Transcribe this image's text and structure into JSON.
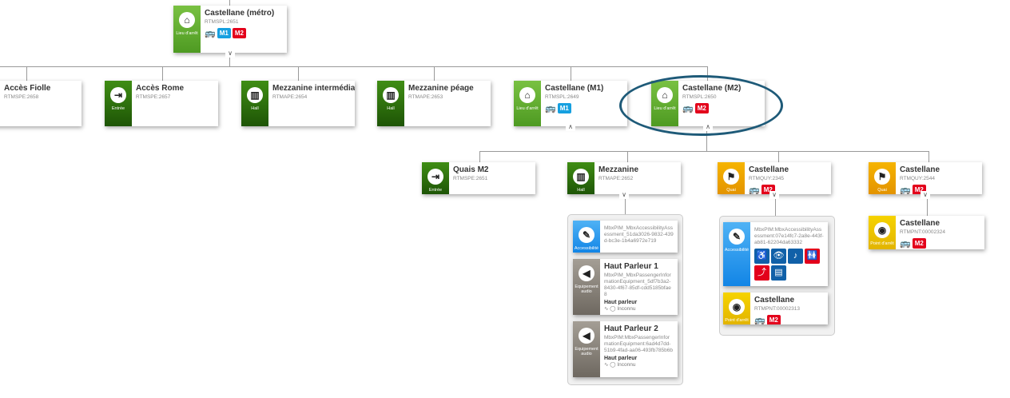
{
  "cards": [
    {
      "name": "castellane-metro",
      "type": "Lieu d'arrêt",
      "color": "green-light",
      "icon": "building-icon",
      "glyph": "⌂",
      "title": "Castellane (métro)",
      "id": "RTMSPL:2651",
      "bus": true,
      "lines": [
        "M1",
        "M2"
      ]
    },
    {
      "name": "acces-fiolle",
      "type": "",
      "color": "green-dark",
      "icon": "",
      "glyph": "",
      "title": "Accès Fiolle",
      "id": "RTMSPE:2658",
      "lines": []
    },
    {
      "name": "acces-rome",
      "type": "Entrée",
      "color": "green-dark",
      "icon": "entrance-icon",
      "glyph": "⇥",
      "title": "Accès Rome",
      "id": "RTMSPE:2657",
      "lines": []
    },
    {
      "name": "mezzanine-intermediaire",
      "type": "Hall",
      "color": "green-dark",
      "icon": "hall-icon",
      "glyph": "▥",
      "title": "Mezzanine intermédiaire",
      "id": "RTMAPE:2654",
      "lines": []
    },
    {
      "name": "mezzanine-peage",
      "type": "Hall",
      "color": "green-dark",
      "icon": "hall-icon",
      "glyph": "▥",
      "title": "Mezzanine péage",
      "id": "RTMAPE:2653",
      "lines": []
    },
    {
      "name": "castellane-m1",
      "type": "Lieu d'arrêt",
      "color": "green-light",
      "icon": "building-icon",
      "glyph": "⌂",
      "title": "Castellane (M1)",
      "id": "RTMSPL:2649",
      "bus": true,
      "lines": [
        "M1"
      ]
    },
    {
      "name": "castellane-m2",
      "type": "Lieu d'arrêt",
      "color": "green-light",
      "icon": "building-icon",
      "glyph": "⌂",
      "title": "Castellane (M2)",
      "id": "RTMSPL:2650",
      "bus": true,
      "lines": [
        "M2"
      ]
    },
    {
      "name": "quais-m2",
      "type": "Entrée",
      "color": "green-dark",
      "icon": "entrance-icon",
      "glyph": "⇥",
      "title": "Quais M2",
      "id": "RTMSPE:2651",
      "lines": []
    },
    {
      "name": "mezzanine",
      "type": "Hall",
      "color": "green-dark",
      "icon": "hall-icon",
      "glyph": "▥",
      "title": "Mezzanine",
      "id": "RTMAPE:2652",
      "lines": []
    },
    {
      "name": "quai-castellane-2345",
      "type": "Quai",
      "color": "orange",
      "icon": "quay-icon",
      "glyph": "⚑",
      "title": "Castellane",
      "id": "RTMQUY:2345",
      "bus": true,
      "lines": [
        "M2"
      ]
    },
    {
      "name": "quai-castellane-2544",
      "type": "Quai",
      "color": "orange",
      "icon": "quay-icon",
      "glyph": "⚑",
      "title": "Castellane",
      "id": "RTMQUY:2544",
      "bus": true,
      "lines": [
        "M2"
      ]
    },
    {
      "name": "accessibility-1",
      "type": "Accessibilité",
      "color": "blue",
      "icon": "accessibility-icon",
      "glyph": "✎",
      "title": "",
      "id": "MbxPIM_MbxAccessibilityAssessment_51da3026-9832-439d-bc3e-1b4a6972e719",
      "lines": []
    },
    {
      "name": "haut-parleur-1",
      "type": "Equipement audio",
      "color": "grey",
      "icon": "speaker-icon",
      "glyph": "◀",
      "title": "Haut Parleur 1",
      "id": "MbxPIM_MbxPassengerInformationEquipment_5df7b3a2-8430-4f67-85df-cdd5185bfae8",
      "equip": "Haut parleur",
      "status": "Inconnu",
      "lines": []
    },
    {
      "name": "haut-parleur-2",
      "type": "Equipement audio",
      "color": "grey",
      "icon": "speaker-icon",
      "glyph": "◀",
      "title": "Haut Parleur 2",
      "id": "MbxPIM:MbxPassengerInformationEquipment:6ad4d7dd-51b9-4fad-aa06-493fb785b6b",
      "equip": "Haut parleur",
      "status": "Inconnu",
      "lines": []
    },
    {
      "name": "accessibility-2",
      "type": "Accessibilité",
      "color": "blue",
      "icon": "accessibility-icon",
      "glyph": "✎",
      "title": "",
      "id": "MbxPIM:MbxAccessibilityAssessment:07e14fc7-2a8e-443f-ab81-62204da63332",
      "acc": true,
      "lines": []
    },
    {
      "name": "point-castellane-2313",
      "type": "Point d'arrêt",
      "color": "yellow",
      "icon": "stop-point-icon",
      "glyph": "◉",
      "title": "Castellane",
      "id": "RTMPNT:00002313",
      "bus": true,
      "lines": [
        "M2"
      ]
    },
    {
      "name": "point-castellane-2324",
      "type": "Point d'arrêt",
      "color": "yellow",
      "icon": "stop-point-icon",
      "glyph": "◉",
      "title": "Castellane",
      "id": "RTMPNT:00002324",
      "bus": true,
      "lines": [
        "M2"
      ]
    }
  ],
  "accessibility_icons": [
    {
      "name": "wheelchair-icon",
      "glyph": "♿",
      "color": "#1060a8"
    },
    {
      "name": "visual-icon",
      "glyph": "👁",
      "color": "#1060a8"
    },
    {
      "name": "hearing-icon",
      "glyph": "♪",
      "color": "#1060a8"
    },
    {
      "name": "toilets-icon",
      "glyph": "🚻",
      "color": "#e3001b"
    },
    {
      "name": "escalator-icon",
      "glyph": "⤴",
      "color": "#e3001b"
    },
    {
      "name": "lift-icon",
      "glyph": "▤",
      "color": "#1060a8"
    }
  ]
}
